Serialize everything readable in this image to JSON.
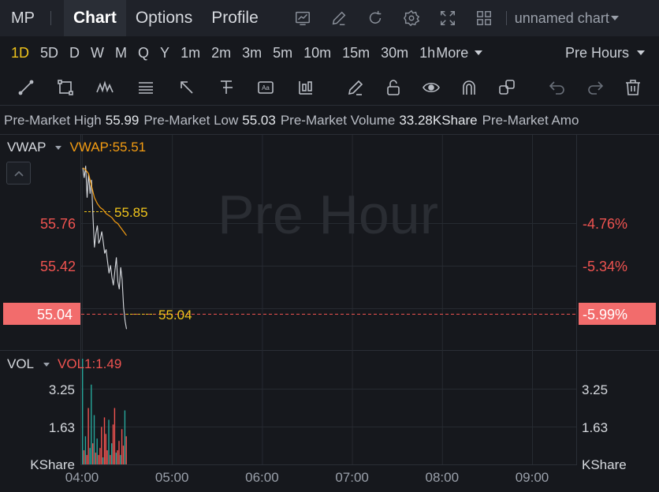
{
  "header": {
    "ticker": "MP",
    "tabs": [
      {
        "label": "Chart",
        "active": true
      },
      {
        "label": "Options",
        "active": false
      },
      {
        "label": "Profile",
        "active": false
      }
    ],
    "icons": [
      "indicator-chart-icon",
      "draw-pen-icon",
      "refresh-icon",
      "settings-gear-icon",
      "fullscreen-icon",
      "layout-grid-icon"
    ],
    "chart_name": "unnamed chart"
  },
  "intervals": {
    "items": [
      "1D",
      "5D",
      "D",
      "W",
      "M",
      "Q",
      "Y",
      "1m",
      "2m",
      "3m",
      "5m",
      "10m",
      "15m",
      "30m",
      "1h"
    ],
    "active": "1D",
    "more_label": "More",
    "session_label": "Pre Hours"
  },
  "drawing_tools": [
    "trend-line-icon",
    "rectangle-icon",
    "pattern-icon",
    "fibonacci-icon",
    "arrow-icon",
    "measure-icon",
    "text-icon",
    "long-short-icon",
    "brush-icon",
    "lock-icon",
    "eye-icon",
    "magnet-icon",
    "layers-icon",
    "undo-icon",
    "redo-icon",
    "trash-icon"
  ],
  "info": {
    "high_label": "Pre-Market High",
    "high_value": "55.99",
    "low_label": "Pre-Market Low",
    "low_value": "55.03",
    "volume_label": "Pre-Market Volume",
    "volume_value": "33.28KShare",
    "amount_label": "Pre-Market Amo"
  },
  "main_pane": {
    "indicator_name": "VWAP",
    "indicator_value": "VWAP:55.51",
    "watermark": "Pre Hour",
    "high_marker": "55.85",
    "last_marker": "55.04",
    "price_labels_left": [
      "55.76",
      "55.42"
    ],
    "price_labels_right": [
      "-4.76%",
      "-5.34%"
    ],
    "current_price": "55.04",
    "current_pct": "-5.99%"
  },
  "volume_pane": {
    "indicator_name": "VOL",
    "indicator_value": "VOL1:1.49",
    "labels_left": [
      "3.25",
      "1.63",
      "KShare"
    ],
    "labels_right": [
      "3.25",
      "1.63",
      "KShare"
    ]
  },
  "colors": {
    "background": "#16181d",
    "up": "#26a69a",
    "down": "#ef5350",
    "vwap": "#f39c12",
    "marker": "#f0c41b",
    "price_line": "#d6d9de",
    "active_interval": "#f0c41b"
  },
  "chart_data": {
    "type": "line",
    "x_ticks": [
      "04:00",
      "05:00",
      "06:00",
      "07:00",
      "08:00",
      "09:00"
    ],
    "ylim": [
      54.95,
      56.0
    ],
    "price": {
      "name": "price",
      "x": [
        0,
        1,
        2,
        3,
        4,
        5,
        6,
        7,
        8,
        9,
        10,
        11,
        12,
        13,
        14,
        15,
        16,
        17,
        18,
        19,
        20,
        21,
        22,
        23,
        24,
        25,
        26,
        27,
        28,
        29,
        30
      ],
      "y": [
        55.85,
        55.8,
        55.86,
        55.7,
        55.82,
        55.72,
        55.79,
        55.6,
        55.45,
        55.52,
        55.56,
        55.47,
        55.49,
        55.53,
        55.48,
        55.42,
        55.44,
        55.38,
        55.32,
        55.36,
        55.3,
        55.26,
        55.33,
        55.4,
        55.28,
        55.24,
        55.35,
        55.29,
        55.15,
        55.08,
        55.04
      ]
    },
    "vwap": {
      "name": "VWAP",
      "x": [
        0,
        2,
        4,
        6,
        8,
        10,
        12,
        14,
        16,
        18,
        20,
        22,
        24,
        26,
        28,
        30
      ],
      "y": [
        55.85,
        55.84,
        55.82,
        55.76,
        55.7,
        55.67,
        55.65,
        55.64,
        55.62,
        55.61,
        55.6,
        55.58,
        55.57,
        55.55,
        55.53,
        55.51
      ]
    },
    "volume": {
      "name": "VOL",
      "ylim": [
        0,
        4.5
      ],
      "values": [
        4.6,
        0.6,
        1.2,
        0.4,
        2.4,
        0.7,
        3.4,
        0.9,
        2.1,
        0.5,
        1.1,
        0.4,
        0.7,
        1.6,
        0.3,
        2.0,
        1.3,
        0.6,
        1.9,
        0.4,
        0.9,
        1.7,
        2.4,
        0.5,
        0.6,
        1.0,
        0.4,
        1.5,
        0.8,
        2.3,
        1.2
      ],
      "up": [
        true,
        false,
        true,
        false,
        false,
        true,
        true,
        false,
        true,
        false,
        true,
        false,
        false,
        false,
        true,
        false,
        false,
        false,
        true,
        false,
        true,
        false,
        false,
        true,
        false,
        false,
        true,
        false,
        false,
        true,
        false
      ]
    }
  }
}
